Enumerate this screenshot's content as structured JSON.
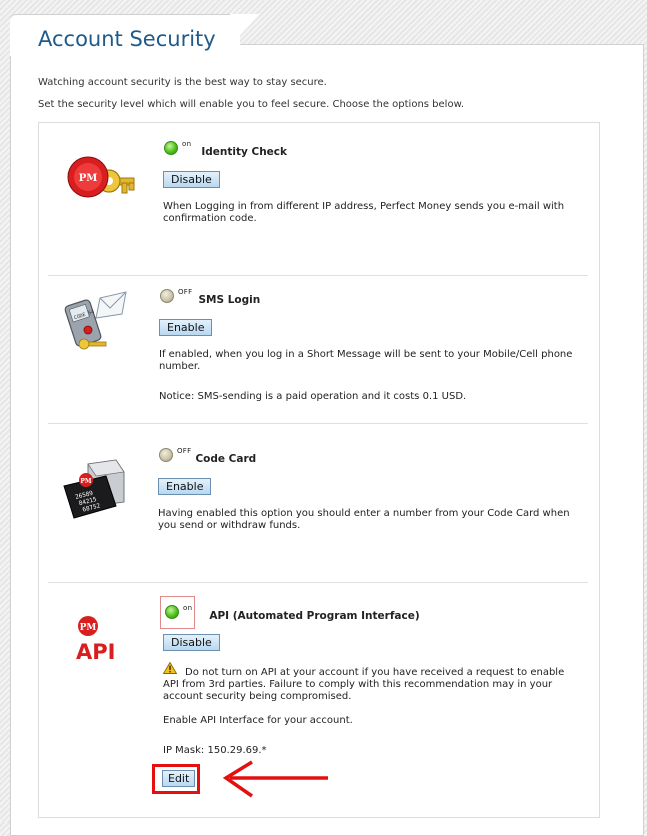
{
  "page": {
    "title": "Account Security",
    "intro_line1": "Watching account security is the best way to stay secure.",
    "intro_line2": "Set the security level which will enable you to feel secure. Choose the options below."
  },
  "sections": [
    {
      "name": "Identity Check",
      "state": "on",
      "button": "Disable",
      "description": "When Logging in from different IP address, Perfect Money sends you e-mail with confirmation code."
    },
    {
      "name": "SMS Login",
      "state": "OFF",
      "button": "Enable",
      "description": "If enabled, when you log in a Short Message will be sent to your Mobile/Cell phone number.",
      "notice": "Notice: SMS-sending is a paid operation and it costs 0.1 USD."
    },
    {
      "name": "Code Card",
      "state": "OFF",
      "button": "Enable",
      "description": "Having enabled this option you should enter a number from your Code Card when you send or withdraw funds."
    },
    {
      "name": "API (Automated Program Interface)",
      "state": "on",
      "button": "Disable",
      "warning": "Do not turn on API at your account if you have received a request to enable API from 3rd parties. Failure to comply with this recommendation may in your account security being compromised.",
      "enable_text": "Enable API Interface for your account.",
      "ip_mask": "IP Mask: 150.29.69.*",
      "edit_button": "Edit"
    }
  ],
  "icons": {
    "pm_badge_text": "PM",
    "api_logo_text": "API",
    "phone_screen_text": "CODE 54",
    "card_text_lines": [
      "26589",
      "84215",
      "68752"
    ]
  },
  "colors": {
    "title": "#1f5a8a",
    "led_on": "#4cc21c",
    "led_off": "#c9c2a6",
    "annotation_red": "#e41010",
    "pm_red": "#d81e1e"
  }
}
